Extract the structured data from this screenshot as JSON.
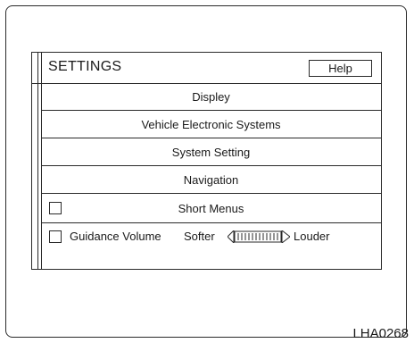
{
  "settings": {
    "title": "SETTINGS",
    "help_label": "Help"
  },
  "menu": {
    "items": [
      {
        "label": "Displey"
      },
      {
        "label": "Vehicle Electronic Systems"
      },
      {
        "label": "System Setting"
      },
      {
        "label": "Navigation"
      }
    ],
    "short_menus": {
      "label": "Short Menus",
      "checked": false
    }
  },
  "volume": {
    "label": "Guidance Volume",
    "checked": false,
    "softer_label": "Softer",
    "louder_label": "Louder"
  },
  "figure_code": "LHA0268"
}
